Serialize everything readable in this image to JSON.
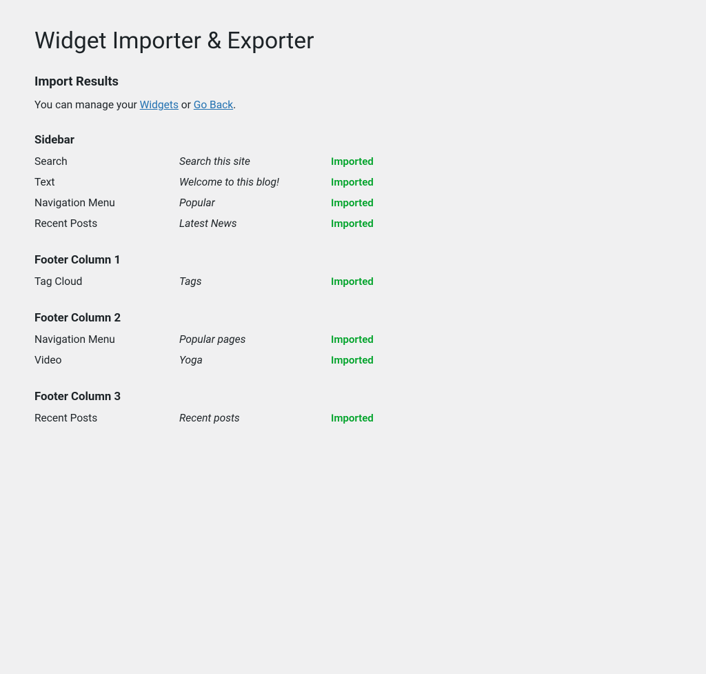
{
  "page": {
    "title": "Widget Importer & Exporter",
    "import_results_heading": "Import Results",
    "manage_text_prefix": "You can manage your ",
    "widgets_link": "Widgets",
    "manage_text_middle": " or ",
    "go_back_link": "Go Back",
    "manage_text_suffix": "."
  },
  "sections": [
    {
      "id": "sidebar",
      "label": "Sidebar",
      "widgets": [
        {
          "name": "Search",
          "title": "Search this site",
          "status": "Imported"
        },
        {
          "name": "Text",
          "title": "Welcome to this blog!",
          "status": "Imported"
        },
        {
          "name": "Navigation Menu",
          "title": "Popular",
          "status": "Imported"
        },
        {
          "name": "Recent Posts",
          "title": "Latest News",
          "status": "Imported"
        }
      ]
    },
    {
      "id": "footer-column-1",
      "label": "Footer Column 1",
      "widgets": [
        {
          "name": "Tag Cloud",
          "title": "Tags",
          "status": "Imported"
        }
      ]
    },
    {
      "id": "footer-column-2",
      "label": "Footer Column 2",
      "widgets": [
        {
          "name": "Navigation Menu",
          "title": "Popular pages",
          "status": "Imported"
        },
        {
          "name": "Video",
          "title": "Yoga",
          "status": "Imported"
        }
      ]
    },
    {
      "id": "footer-column-3",
      "label": "Footer Column 3",
      "widgets": [
        {
          "name": "Recent Posts",
          "title": "Recent posts",
          "status": "Imported"
        }
      ]
    }
  ],
  "colors": {
    "status_imported": "#00a32a",
    "link_color": "#2271b1"
  }
}
